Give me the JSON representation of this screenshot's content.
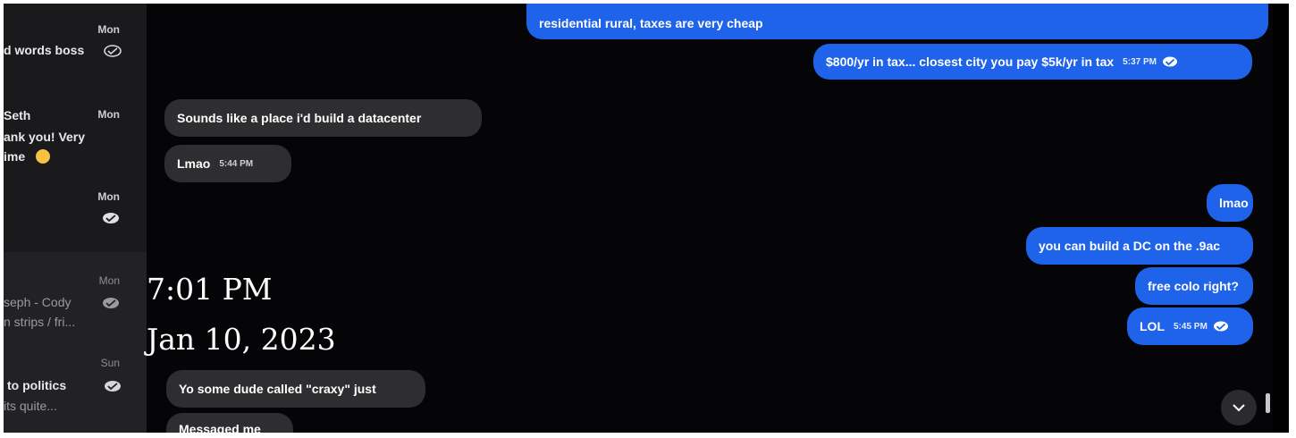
{
  "sidebar": {
    "conversations": [
      {
        "day": "Mon",
        "preview_line1": "d words boss",
        "preview_line2": "",
        "read": true
      },
      {
        "day": "Mon",
        "name": "Seth",
        "preview_line1": "ank you! Very",
        "preview_line2": "ime",
        "emoji": "smile-emoji"
      },
      {
        "day": "Mon",
        "read": true
      },
      {
        "day": "Mon",
        "preview_line1": "seph - Cody",
        "preview_line2": "n strips / fri...",
        "read": true
      },
      {
        "day": "Sun",
        "preview_line1": "to politics",
        "preview_line2": "its quite...",
        "read": true
      }
    ]
  },
  "chat": {
    "messages": [
      {
        "id": "m1",
        "direction": "out",
        "text": "residential rural, taxes are very cheap"
      },
      {
        "id": "m2",
        "direction": "out",
        "text": "$800/yr in tax... closest city you pay $5k/yr in tax",
        "time": "5:37 PM"
      },
      {
        "id": "m3",
        "direction": "in",
        "text": "Sounds like a place i'd build a datacenter"
      },
      {
        "id": "m4",
        "direction": "in",
        "text": "Lmao",
        "time": "5:44 PM"
      },
      {
        "id": "m5",
        "direction": "out",
        "text": "lmao"
      },
      {
        "id": "m6",
        "direction": "out",
        "text": "you can build a DC on the .9ac"
      },
      {
        "id": "m7",
        "direction": "out",
        "text": "free colo right?"
      },
      {
        "id": "m8",
        "direction": "out",
        "text": "LOL",
        "time": "5:45 PM"
      },
      {
        "id": "m9",
        "direction": "in",
        "text": "Yo some dude called \"craxy\" just"
      },
      {
        "id": "m10",
        "direction": "in",
        "text": "Messaged me"
      }
    ]
  },
  "overlay": {
    "time": "7:01 PM",
    "date": "Jan 10, 2023"
  },
  "colors": {
    "outgoing_bubble": "#1f63ea",
    "incoming_bubble": "#2e2e31",
    "background": "#050507"
  }
}
